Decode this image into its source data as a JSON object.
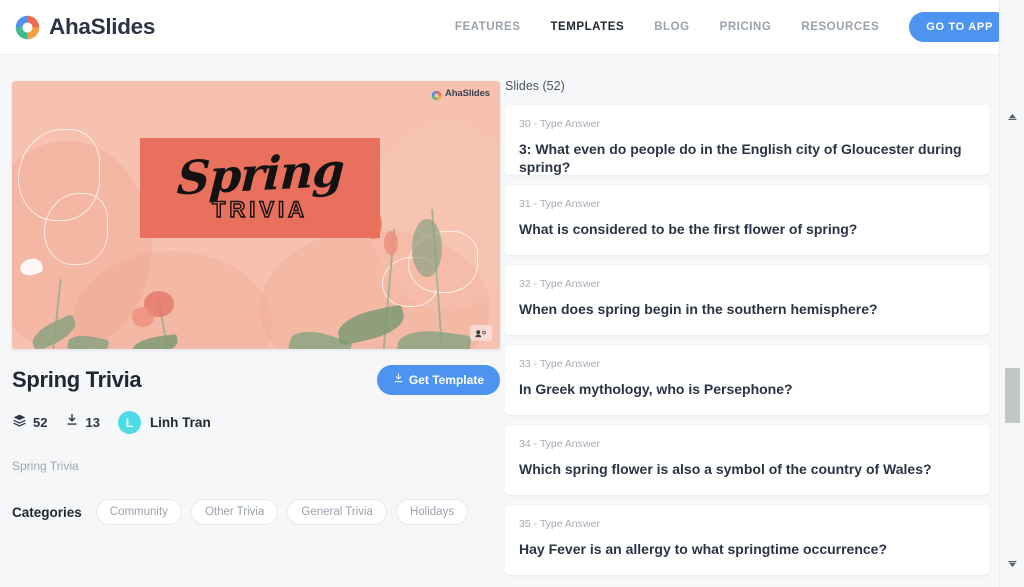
{
  "header": {
    "brand": "AhaSlides",
    "logo_icon": "ahaslides-donut-logo",
    "nav": [
      {
        "label": "FEATURES",
        "active": false
      },
      {
        "label": "TEMPLATES",
        "active": true
      },
      {
        "label": "BLOG",
        "active": false
      },
      {
        "label": "PRICING",
        "active": false
      },
      {
        "label": "RESOURCES",
        "active": false
      }
    ],
    "cta_label": "GO TO APP",
    "cta_color": "#4d94f0"
  },
  "preview": {
    "watermark": "AhaSlides",
    "title_script": "Spring",
    "title_sub": "TRIVIA",
    "card_color": "#e8705c",
    "background_color": "#f6c1ae",
    "badge_icon": "participants-badge-icon"
  },
  "template": {
    "title": "Spring Trivia",
    "get_button_label": "Get Template",
    "get_button_icon": "download-icon",
    "slides_count": "52",
    "slides_icon": "layers-icon",
    "downloads_count": "13",
    "downloads_icon": "download-icon",
    "author_initial": "L",
    "author_name": "Linh Tran",
    "avatar_color": "#4ddbe6",
    "description": "Spring Trivia",
    "categories_label": "Categories",
    "categories": [
      "Community",
      "Other Trivia",
      "General Trivia",
      "Holidays"
    ]
  },
  "slides_panel": {
    "heading": "Slides (52)",
    "cards": [
      {
        "meta": "30 - Type Answer",
        "question": "3: What even do people do in the English city of Gloucester during spring?"
      },
      {
        "meta": "31 - Type Answer",
        "question": "What is considered to be the first flower of spring?"
      },
      {
        "meta": "32 - Type Answer",
        "question": " When does spring begin in the southern hemisphere?"
      },
      {
        "meta": "33 - Type Answer",
        "question": "In Greek mythology, who is Persephone?"
      },
      {
        "meta": "34 - Type Answer",
        "question": "Which spring flower is also a symbol of the country of Wales?"
      },
      {
        "meta": "35 - Type Answer",
        "question": "Hay Fever is an allergy to what springtime occurrence?"
      }
    ]
  },
  "scrollbar": {
    "up_icon": "scroll-up-arrow-icon",
    "down_icon": "scroll-down-arrow-icon",
    "thumb_color": "#c2c6c6"
  }
}
